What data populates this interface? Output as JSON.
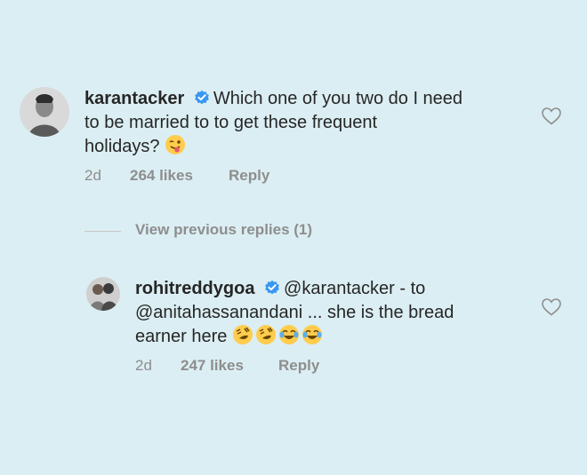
{
  "comments": [
    {
      "username": "karantacker",
      "text_lines": [
        "Which one of you two do I need",
        "to be married to to get these frequent",
        "holidays?"
      ],
      "emojis": [
        "winking-tongue-emoji"
      ],
      "time": "2d",
      "likes": "264 likes",
      "reply": "Reply"
    },
    {
      "username": "rohitreddygoa",
      "text_lines": [
        "@karantacker - to",
        "@anitahassanandani ... she is the bread",
        "earner here"
      ],
      "emojis": [
        "rofl-emoji",
        "rofl-emoji",
        "joy-emoji",
        "joy-emoji"
      ],
      "time": "2d",
      "likes": "247 likes",
      "reply": "Reply"
    }
  ],
  "view_replies": "View previous replies (1)",
  "colors": {
    "background": "#dbeef3",
    "text": "#262626",
    "muted": "#8e8e8e",
    "verified": "#3897f0",
    "emoji": "#ffcc4d"
  }
}
